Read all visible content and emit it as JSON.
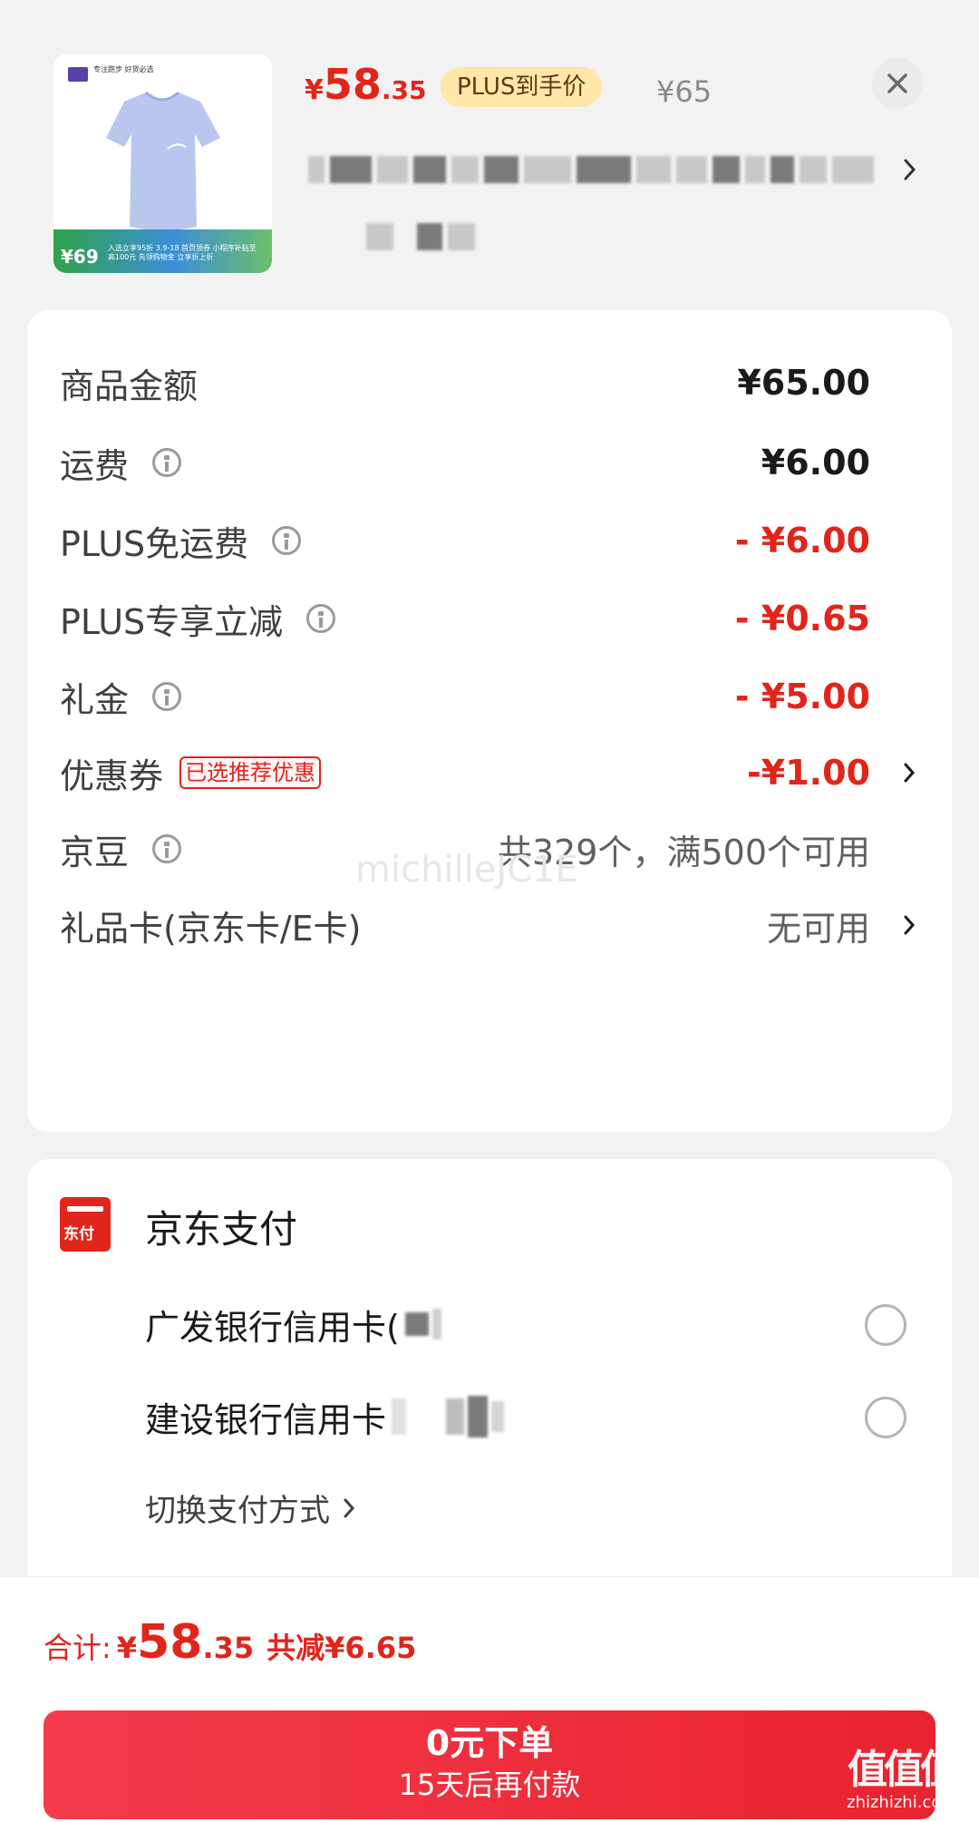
{
  "product": {
    "price_symbol": "¥",
    "price_integer": "58",
    "price_decimal": ".35",
    "plus_tag": "PLUS到手价",
    "original_price": "¥65",
    "thumb": {
      "price": "¥69",
      "badge_text": "专注跑步 好货必选",
      "caption": "入选立享95折 3.9-18 首页领券 小程序补贴至高100元 先领购物金 立享折上折"
    }
  },
  "summary": {
    "rows": [
      {
        "label": "商品金额",
        "value": "¥65.00"
      },
      {
        "label": "运费",
        "value": "¥6.00"
      },
      {
        "label": "PLUS免运费",
        "value": "- ¥6.00"
      },
      {
        "label": "PLUS专享立减",
        "value": "- ¥0.65"
      },
      {
        "label": "礼金",
        "value": "- ¥5.00"
      },
      {
        "label": "优惠券",
        "tag": "已选推荐优惠",
        "value": "-¥1.00"
      },
      {
        "label": "京豆",
        "value": "共329个，满500个可用"
      },
      {
        "label": "礼品卡(京东卡/E卡)",
        "value": "无可用"
      }
    ],
    "watermark": "michilleJC1E"
  },
  "payment": {
    "icon_text": "东付",
    "title": "京东支付",
    "banks": [
      {
        "label": "广发银行信用卡("
      },
      {
        "label": "建设银行信用卡"
      }
    ],
    "switch_label": "切换支付方式"
  },
  "bottom": {
    "total_label": "合计:",
    "total_symbol": "¥",
    "total_integer": "58",
    "total_decimal": ".35",
    "saved": "共减¥6.65",
    "button_main": "0元下单",
    "button_sub": "15天后再付款"
  },
  "site_logo": {
    "glyph": "值值值",
    "url": "zhizhizhi.com"
  },
  "colors": {
    "accent_red": "#e1251b",
    "plus_gold": "#ffe7a8",
    "background": "#f2f2f2"
  },
  "icons": [
    "close-icon",
    "info-icon",
    "chevron-right-icon",
    "jdpay-icon",
    "radio-icon"
  ]
}
